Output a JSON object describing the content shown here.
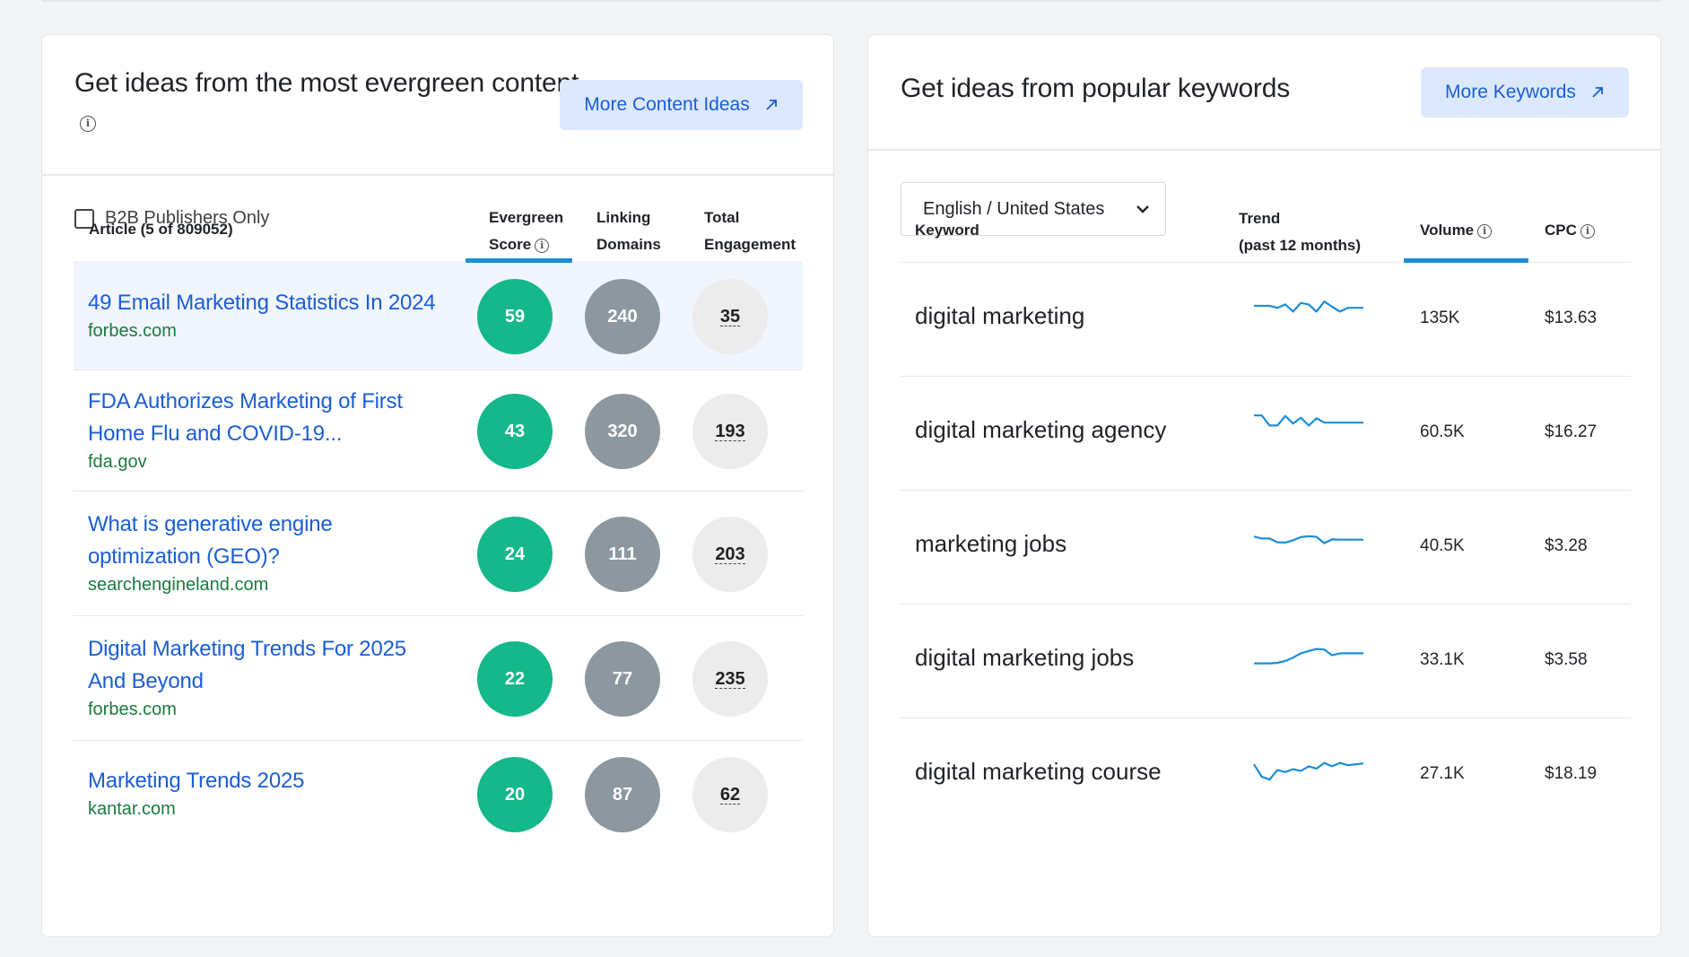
{
  "evergreen": {
    "title": "Get ideas from the most evergreen content",
    "button_label": "More Content Ideas",
    "checkbox_label": "B2B Publishers Only",
    "columns": {
      "article": "Article (5 of 809052)",
      "score_line1": "Evergreen",
      "score_line2": "Score",
      "linking_line1": "Linking",
      "linking_line2": "Domains",
      "engagement_line1": "Total",
      "engagement_line2": "Engagement"
    },
    "rows": [
      {
        "title_lines": [
          "49 Email Marketing Statistics In 2024"
        ],
        "domain": "forbes.com",
        "score": "59",
        "linking": "240",
        "engagement": "35"
      },
      {
        "title_lines": [
          "FDA Authorizes Marketing of First",
          "Home Flu and COVID-19..."
        ],
        "domain": "fda.gov",
        "score": "43",
        "linking": "320",
        "engagement": "193"
      },
      {
        "title_lines": [
          "What is generative engine",
          "optimization (GEO)?"
        ],
        "domain": "searchengineland.com",
        "score": "24",
        "linking": "111",
        "engagement": "203"
      },
      {
        "title_lines": [
          "Digital Marketing Trends For 2025",
          "And Beyond"
        ],
        "domain": "forbes.com",
        "score": "22",
        "linking": "77",
        "engagement": "235"
      },
      {
        "title_lines": [
          "Marketing Trends 2025"
        ],
        "domain": "kantar.com",
        "score": "20",
        "linking": "87",
        "engagement": "62"
      }
    ]
  },
  "keywords": {
    "title": "Get ideas from popular keywords",
    "button_label": "More Keywords",
    "language_select": "English / United States",
    "columns": {
      "keyword": "Keyword",
      "trend_line1": "Trend",
      "trend_line2": "(past 12 months)",
      "volume": "Volume",
      "cpc": "CPC"
    },
    "trend_color": "#1a8ed6",
    "rows": [
      {
        "keyword": "digital marketing",
        "volume": "135K",
        "cpc": "$13.63",
        "trend": [
          0.25,
          0.25,
          0.25,
          0.32,
          0.2,
          0.45,
          0.15,
          0.2,
          0.45,
          0.1,
          0.28,
          0.45,
          0.32,
          0.32,
          0.32
        ]
      },
      {
        "keyword": "digital marketing agency",
        "volume": "60.5K",
        "cpc": "$16.27",
        "trend": [
          0.1,
          0.1,
          0.45,
          0.45,
          0.12,
          0.38,
          0.18,
          0.45,
          0.2,
          0.35,
          0.35,
          0.35,
          0.35,
          0.35,
          0.35
        ]
      },
      {
        "keyword": "marketing jobs",
        "volume": "40.5K",
        "cpc": "$3.28",
        "trend": [
          0.35,
          0.42,
          0.42,
          0.55,
          0.56,
          0.48,
          0.37,
          0.34,
          0.36,
          0.58,
          0.45,
          0.46,
          0.46,
          0.46,
          0.46
        ]
      },
      {
        "keyword": "digital marketing jobs",
        "volume": "33.1K",
        "cpc": "$3.58",
        "trend": [
          0.8,
          0.8,
          0.8,
          0.78,
          0.72,
          0.6,
          0.45,
          0.37,
          0.3,
          0.32,
          0.52,
          0.45,
          0.45,
          0.45,
          0.45
        ]
      },
      {
        "keyword": "digital marketing course",
        "volume": "27.1K",
        "cpc": "$18.19",
        "trend": [
          0.35,
          0.78,
          0.88,
          0.55,
          0.62,
          0.52,
          0.58,
          0.42,
          0.5,
          0.3,
          0.42,
          0.3,
          0.38,
          0.35,
          0.32
        ]
      }
    ]
  }
}
